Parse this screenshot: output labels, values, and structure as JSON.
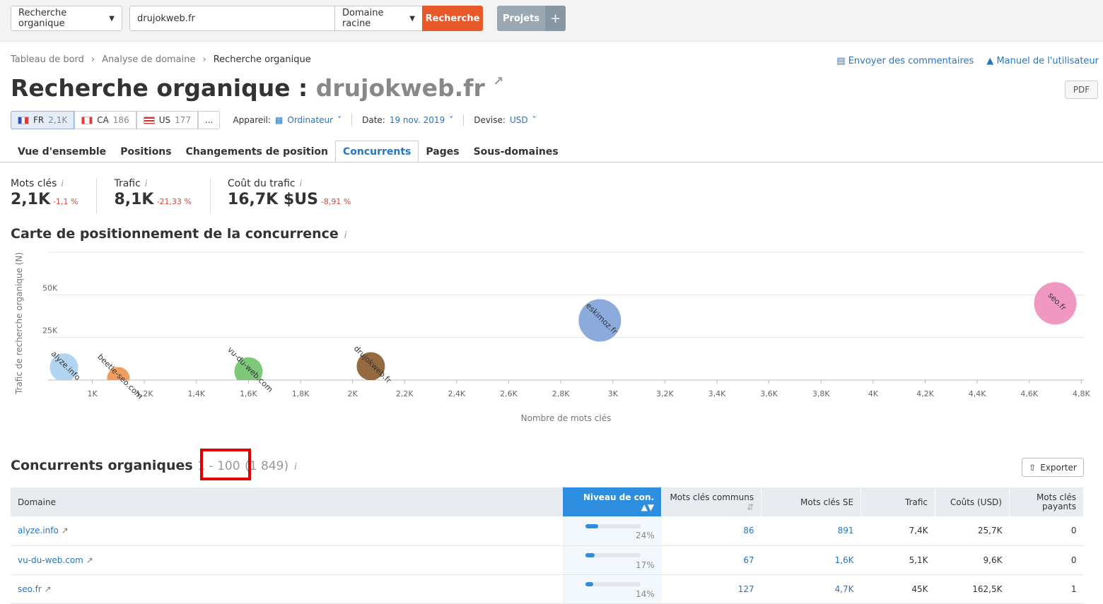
{
  "topbar": {
    "report_select": "Recherche organique",
    "domain_input": "drujokweb.fr",
    "scope_select": "Domaine racine",
    "search_button": "Recherche",
    "projects_button": "Projets",
    "plus_label": "+"
  },
  "breadcrumb": [
    "Tableau de bord",
    "Analyse de domaine",
    "Recherche organique"
  ],
  "links": {
    "feedback": "Envoyer des commentaires",
    "manual": "Manuel de l'utilisateur"
  },
  "header": {
    "title_prefix": "Recherche organique :",
    "domain": "drujokweb.fr",
    "pdf": "PDF"
  },
  "databases": [
    {
      "code": "FR",
      "count": "2,1K"
    },
    {
      "code": "CA",
      "count": "186"
    },
    {
      "code": "US",
      "count": "177"
    }
  ],
  "more_label": "...",
  "options": {
    "device_label": "Appareil:",
    "device_value": "Ordinateur",
    "date_label": "Date:",
    "date_value": "19 nov. 2019",
    "currency_label": "Devise:",
    "currency_value": "USD"
  },
  "tabs": [
    "Vue d'ensemble",
    "Positions",
    "Changements de position",
    "Concurrents",
    "Pages",
    "Sous-domaines"
  ],
  "metrics": [
    {
      "label": "Mots clés",
      "value": "2,1K",
      "delta": "-1,1 %"
    },
    {
      "label": "Trafic",
      "value": "8,1K",
      "delta": "-21,33 %"
    },
    {
      "label": "Coût du trafic",
      "value": "16,7K $US",
      "delta": "-8,91 %"
    }
  ],
  "map_title": "Carte de positionnement de la concurrence",
  "chart_data": {
    "type": "scatter",
    "xlabel": "Nombre de mots clés",
    "ylabel": "Trafic de recherche organique (N)",
    "x_ticks": [
      "1K",
      "1,2K",
      "1,4K",
      "1,6K",
      "1,8K",
      "2K",
      "2,2K",
      "2,4K",
      "2,6K",
      "2,8K",
      "3K",
      "3,2K",
      "3,4K",
      "3,6K",
      "3,8K",
      "4K",
      "4,2K",
      "4,4K",
      "4,6K",
      "4,8K"
    ],
    "y_ticks": [
      "25K",
      "50K"
    ],
    "xlim": [
      830,
      4810
    ],
    "ylim": [
      0,
      75000
    ],
    "grid": true,
    "points": [
      {
        "label": "alyze.info",
        "x": 891,
        "y": 7400,
        "color": "#a9cfee"
      },
      {
        "label": "beetle-seo.com",
        "x": 1100,
        "y": 1000,
        "color": "#f2914f"
      },
      {
        "label": "vu-du-web.com",
        "x": 1600,
        "y": 5100,
        "color": "#6fc26a"
      },
      {
        "label": "drujokweb.fr",
        "x": 2070,
        "y": 8100,
        "color": "#8b5a2b"
      },
      {
        "label": "eskimoz.fr",
        "x": 2950,
        "y": 35000,
        "color": "#7fa2d8"
      },
      {
        "label": "seo.fr",
        "x": 4700,
        "y": 45000,
        "color": "#f08dbb"
      }
    ]
  },
  "competitors": {
    "title": "Concurrents organiques",
    "range": "1 - 100",
    "total": "(1 849)",
    "export": "Exporter",
    "columns": [
      "Domaine",
      "Niveau de con.",
      "Mots clés communs",
      "Mots clés SE",
      "Trafic",
      "Coûts (USD)",
      "Mots clés payants"
    ],
    "rows": [
      {
        "domain": "alyze.info",
        "level": 24,
        "level_label": "24%",
        "common": "86",
        "se": "891",
        "traffic": "7,4K",
        "cost": "25,7K",
        "paid": "0"
      },
      {
        "domain": "vu-du-web.com",
        "level": 17,
        "level_label": "17%",
        "common": "67",
        "se": "1,6K",
        "traffic": "5,1K",
        "cost": "9,6K",
        "paid": "0"
      },
      {
        "domain": "seo.fr",
        "level": 14,
        "level_label": "14%",
        "common": "127",
        "se": "4,7K",
        "traffic": "45K",
        "cost": "162,5K",
        "paid": "1"
      }
    ]
  }
}
